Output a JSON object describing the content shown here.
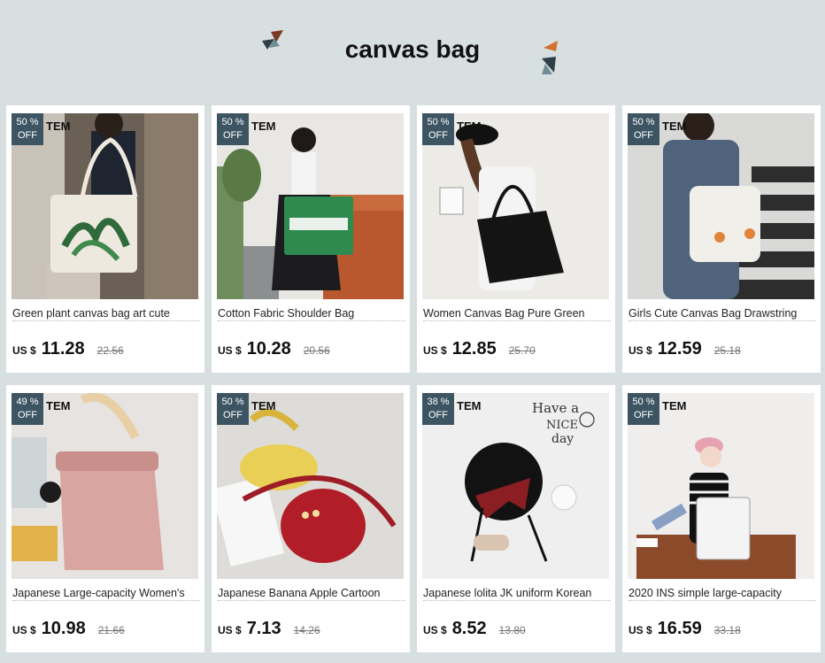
{
  "header": {
    "title": "canvas bag"
  },
  "colors": {
    "badge": "#3d5563",
    "background": "#d8dfe1",
    "card": "#ffffff"
  },
  "products": [
    {
      "discount": "50 %",
      "off": "OFF",
      "tag": "TEM",
      "name": "Green plant canvas bag art cute",
      "currency": "US $",
      "price": "11.28",
      "old_price": "22.56",
      "image": "woman-with-plant-print-tote"
    },
    {
      "discount": "50 %",
      "off": "OFF",
      "tag": "TEM",
      "name": "Cotton Fabric Shoulder Bag",
      "currency": "US $",
      "price": "10.28",
      "old_price": "20.56",
      "image": "girl-with-green-london-review-tote"
    },
    {
      "discount": "50 %",
      "off": "OFF",
      "tag": "TEM",
      "name": "Women Canvas Bag Pure Green",
      "currency": "US $",
      "price": "12.85",
      "old_price": "25.70",
      "image": "girl-with-black-tote"
    },
    {
      "discount": "50 %",
      "off": "OFF",
      "tag": "TEM",
      "name": "Girls Cute Canvas Bag Drawstring",
      "currency": "US $",
      "price": "12.59",
      "old_price": "25.18",
      "image": "denim-girl-with-peach-drawstring-bag"
    },
    {
      "discount": "49 %",
      "off": "OFF",
      "tag": "TEM",
      "name": "Japanese Large-capacity Women's",
      "currency": "US $",
      "price": "10.98",
      "old_price": "21.66",
      "image": "pink-drawstring-tote"
    },
    {
      "discount": "50 %",
      "off": "OFF",
      "tag": "TEM",
      "name": "Japanese Banana Apple Cartoon",
      "currency": "US $",
      "price": "7.13",
      "old_price": "14.26",
      "image": "banana-and-apple-bags"
    },
    {
      "discount": "38 %",
      "off": "OFF",
      "tag": "TEM",
      "name": "Japanese lolita JK uniform Korean",
      "currency": "US $",
      "price": "8.52",
      "old_price": "13.80",
      "image": "black-round-bag-with-red-bow",
      "handwriting": [
        "Have a",
        "NICE",
        "day"
      ]
    },
    {
      "discount": "50 %",
      "off": "OFF",
      "tag": "TEM",
      "name": "2020 INS simple large-capacity",
      "currency": "US $",
      "price": "16.59",
      "old_price": "33.18",
      "image": "girl-on-bench-with-white-tote"
    }
  ]
}
